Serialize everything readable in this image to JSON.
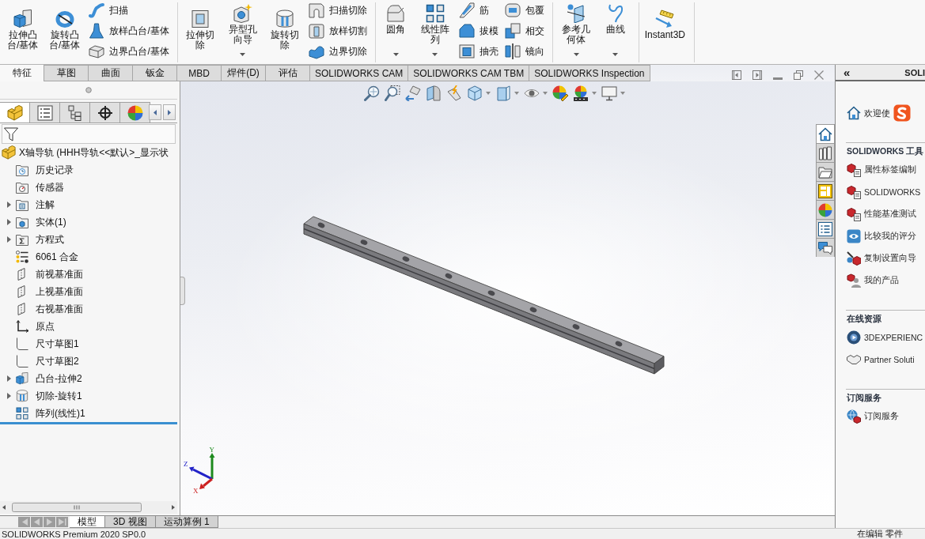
{
  "ribbon": {
    "groups": [
      {
        "large": [
          {
            "label": "拉伸凸台/基体",
            "dropdown": false
          },
          {
            "label": "旋转凸台/基体",
            "dropdown": false
          }
        ],
        "columns": [
          [
            "扫描",
            "放样凸台/基体",
            "边界凸台/基体"
          ]
        ]
      },
      {
        "large": [
          {
            "label": "拉伸切除",
            "dropdown": false
          },
          {
            "label": "异型孔向导",
            "dropdown": true
          },
          {
            "label": "旋转切除",
            "dropdown": false
          }
        ],
        "columns": [
          [
            "扫描切除",
            "放样切割",
            "边界切除"
          ]
        ]
      },
      {
        "large": [
          {
            "label": "圆角",
            "dropdown": true
          },
          {
            "label": "线性阵列",
            "dropdown": true
          }
        ],
        "columns": [
          [
            "筋",
            "拔模",
            "抽壳"
          ],
          [
            "包覆",
            "相交",
            "镜向"
          ]
        ]
      },
      {
        "large": [
          {
            "label": "参考几何体",
            "dropdown": true
          },
          {
            "label": "曲线",
            "dropdown": true
          }
        ]
      },
      {
        "large": [
          {
            "label": "Instant3D",
            "dropdown": false
          }
        ]
      }
    ]
  },
  "command_tabs": [
    {
      "label": "特征",
      "selected": true
    },
    {
      "label": "草图",
      "selected": false
    },
    {
      "label": "曲面",
      "selected": false
    },
    {
      "label": "钣金",
      "selected": false
    },
    {
      "label": "MBD",
      "selected": false
    },
    {
      "label": "焊件(D)",
      "selected": false
    },
    {
      "label": "评估",
      "selected": false
    },
    {
      "label": "SOLIDWORKS CAM",
      "selected": false
    },
    {
      "label": "SOLIDWORKS CAM TBM",
      "selected": false
    },
    {
      "label": "SOLIDWORKS Inspection",
      "selected": false
    }
  ],
  "feature_manager": {
    "manager_tabs": [
      {
        "selected": true
      },
      {
        "selected": false
      },
      {
        "selected": false
      },
      {
        "selected": false
      },
      {
        "selected": false
      }
    ],
    "tree": {
      "label": "X轴导轨 (HHH导轨<<默认>_显示状",
      "children": [
        {
          "label": "历史记录",
          "expandable": false
        },
        {
          "label": "传感器",
          "expandable": false
        },
        {
          "label": "注解",
          "expandable": true
        },
        {
          "label": "实体(1)",
          "expandable": true
        },
        {
          "label": "方程式",
          "expandable": true
        },
        {
          "label": "6061 合金",
          "expandable": false
        },
        {
          "label": "前视基准面",
          "expandable": false
        },
        {
          "label": "上视基准面",
          "expandable": false
        },
        {
          "label": "右视基准面",
          "expandable": false
        },
        {
          "label": "原点",
          "expandable": false
        },
        {
          "label": "尺寸草图1",
          "expandable": false
        },
        {
          "label": "尺寸草图2",
          "expandable": false
        },
        {
          "label": "凸台-拉伸2",
          "expandable": true
        },
        {
          "label": "切除-旋转1",
          "expandable": true
        },
        {
          "label": "阵列(线性)1",
          "expandable": false
        }
      ]
    }
  },
  "graphics_area": {
    "triad": {
      "x": "X",
      "y": "Y",
      "z": "Z"
    }
  },
  "bottom_tabs": [
    {
      "label": "模型",
      "selected": true
    },
    {
      "label": "3D 视图",
      "selected": false
    },
    {
      "label": "运动算例 1",
      "selected": false
    }
  ],
  "task_pane": {
    "collapse_label": "«",
    "title": "SOLI",
    "welcome": "欢迎使",
    "tabs": [
      {
        "selected": true
      },
      {
        "selected": false
      },
      {
        "selected": false
      },
      {
        "selected": false
      },
      {
        "selected": false
      },
      {
        "selected": false
      },
      {
        "selected": false
      }
    ],
    "sections": [
      {
        "title": "SOLIDWORKS 工具",
        "items": [
          "属性标签编制",
          "SOLIDWORKS",
          "性能基准测试",
          "比较我的评分",
          "复制设置向导",
          "我的产品"
        ]
      },
      {
        "title": "在线资源",
        "items": [
          "3DEXPERIENC",
          "Partner Soluti"
        ]
      },
      {
        "title": "订阅服务",
        "items": [
          "订阅服务"
        ]
      }
    ]
  },
  "status_bar": {
    "left": "SOLIDWORKS Premium 2020 SP0.0",
    "right": "在编辑 零件"
  }
}
